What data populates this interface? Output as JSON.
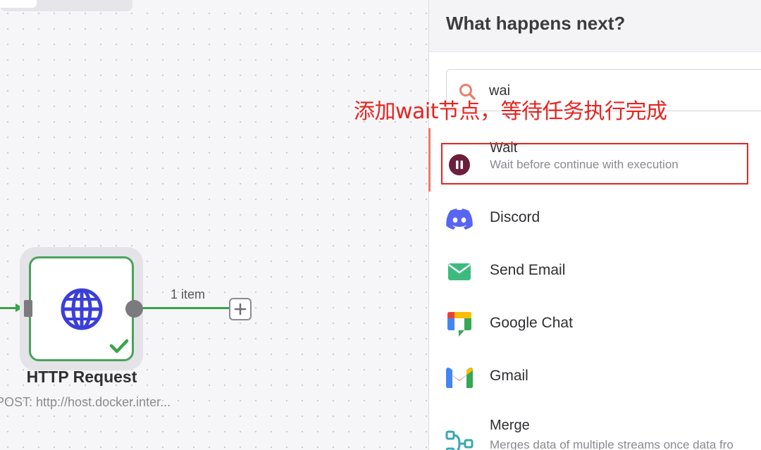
{
  "canvas": {
    "node": {
      "title": "HTTP Request",
      "subtitle": "POST: http://host.docker.inter...",
      "status": "success"
    },
    "edge_label": "1 item",
    "icons": {
      "node": "globe-icon",
      "status": "check-icon",
      "add": "plus-icon"
    }
  },
  "panel": {
    "title": "What happens next?",
    "search": {
      "value": "wai",
      "icon": "search-icon"
    },
    "annotation": "添加wait节点，等待任务执行完成",
    "items": [
      {
        "name": "Wait",
        "description": "Wait before continue with execution",
        "icon": "pause-icon",
        "color": "#6b1f3a"
      },
      {
        "name": "Discord",
        "description": "",
        "icon": "discord-icon",
        "color": "#5865f2"
      },
      {
        "name": "Send Email",
        "description": "",
        "icon": "envelope-icon",
        "color": "#3dbb7f"
      },
      {
        "name": "Google Chat",
        "description": "",
        "icon": "google-chat-icon",
        "color": "#34a853"
      },
      {
        "name": "Gmail",
        "description": "",
        "icon": "gmail-icon",
        "color": "#ea4335"
      },
      {
        "name": "Merge",
        "description": "Merges data of multiple streams once data fro",
        "icon": "merge-icon",
        "color": "#3aa7b5"
      }
    ]
  },
  "colors": {
    "success": "#4aa35b",
    "accent": "#ee7b6b",
    "annotation": "#e52521"
  }
}
